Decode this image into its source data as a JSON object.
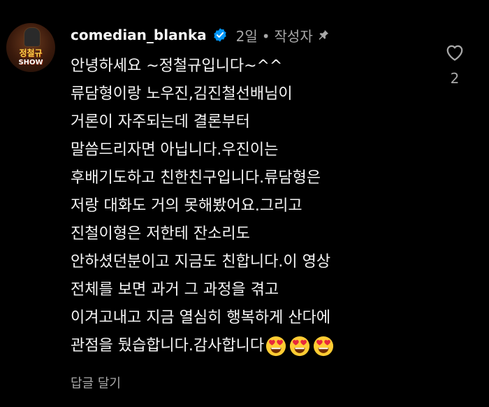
{
  "comment": {
    "username": "comedian_blanka",
    "time_ago": "2일",
    "separator": "•",
    "author_label": "작성자",
    "avatar_text_line1": "정철규",
    "avatar_text_line2": "SHOW",
    "body_lines": [
      "안녕하세요 ~정철규입니다~^^",
      "류담형이랑 노우진,김진철선배님이",
      "거론이 자주되는데 결론부터",
      "말씀드리자면 아닙니다.우진이는",
      "후배기도하고 친한친구입니다.류담형은",
      "저랑 대화도 거의 못해봤어요.그리고",
      "진철이형은 저한테 잔소리도",
      "안하셨던분이고 지금도 친합니다.이 영상",
      "전체를 보면 과거 그 과정을 겪고",
      "이겨고내고 지금 열심히 행복하게 산다에",
      "관점을 뒀습합니다.감사합니다"
    ],
    "emoji": [
      "smiling-face-with-heart-eyes",
      "smiling-face-with-heart-eyes",
      "smiling-face-with-heart-eyes"
    ],
    "reply_label": "답글 달기",
    "like_count": "2"
  },
  "colors": {
    "background": "#000000",
    "text_primary": "#f5f5f5",
    "text_secondary": "#a8a8a8",
    "verified_blue": "#0095f6",
    "emoji_yellow": "#ffcc33",
    "emoji_heart": "#e8283c"
  },
  "icons": {
    "verified": "verified-badge-icon",
    "pin": "pin-icon",
    "like": "heart-outline-icon"
  }
}
